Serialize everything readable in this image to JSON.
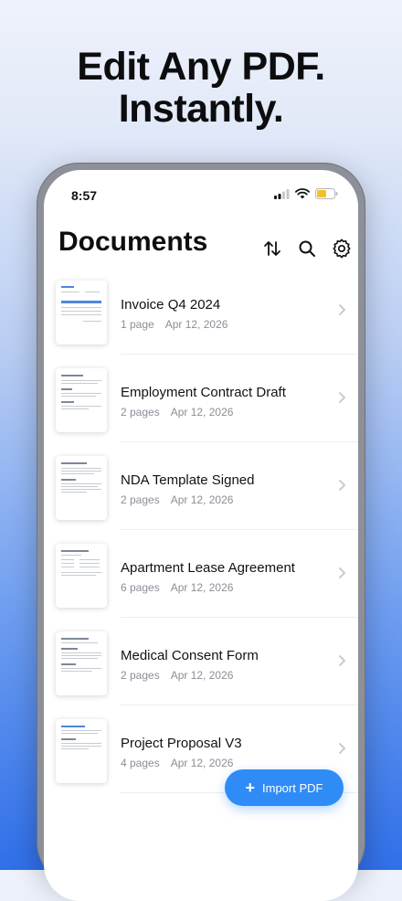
{
  "headline": {
    "line1": "Edit Any PDF.",
    "line2": "Instantly."
  },
  "status": {
    "time": "8:57",
    "icons": [
      "signal-icon",
      "wifi-icon",
      "battery-icon"
    ]
  },
  "header": {
    "title": "Documents",
    "tools": [
      "sort-icon",
      "search-icon",
      "settings-icon"
    ]
  },
  "documents": [
    {
      "name": "Invoice Q4 2024",
      "pages": "1 page",
      "date": "Apr 12, 2026"
    },
    {
      "name": "Employment Contract Draft",
      "pages": "2 pages",
      "date": "Apr 12, 2026"
    },
    {
      "name": "NDA Template Signed",
      "pages": "2 pages",
      "date": "Apr 12, 2026"
    },
    {
      "name": "Apartment Lease Agreement",
      "pages": "6 pages",
      "date": "Apr 12, 2026"
    },
    {
      "name": "Medical Consent Form",
      "pages": "2 pages",
      "date": "Apr 12, 2026"
    },
    {
      "name": "Project Proposal V3",
      "pages": "4 pages",
      "date": "Apr 12, 2026"
    }
  ],
  "fab": {
    "label": "Import PDF"
  },
  "colors": {
    "accent": "#2f8cf6",
    "battery": "#f4c02a"
  }
}
